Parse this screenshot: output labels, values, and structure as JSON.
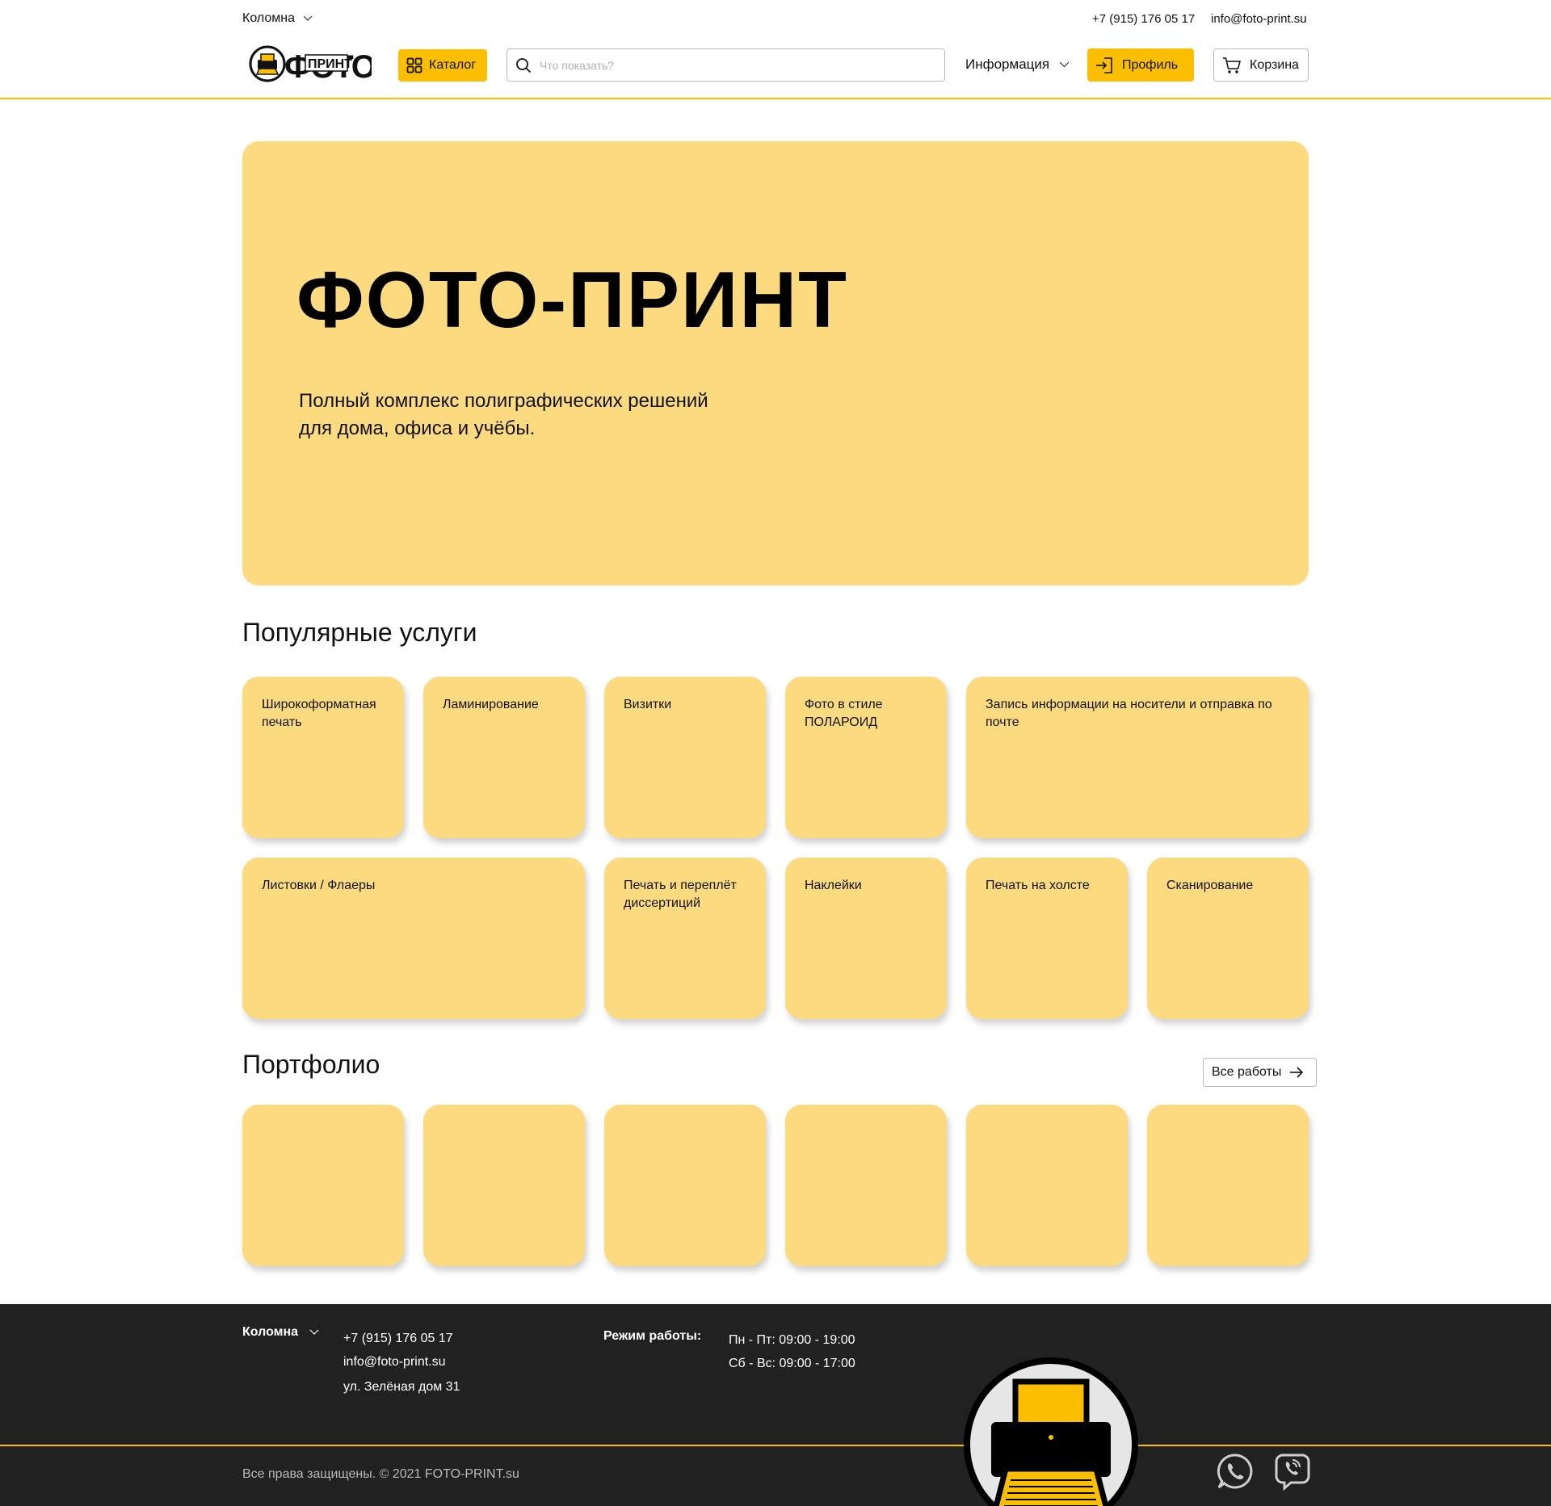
{
  "header": {
    "city": "Коломна",
    "phone": "+7 (915) 176 05 17",
    "email": "info@foto-print.su",
    "catalog_label": "Каталог",
    "search_placeholder": "Что показать?",
    "info_label": "Информация",
    "profile_label": "Профиль",
    "cart_label": "Корзина",
    "logo_text": "ФОТО ПРИНТ"
  },
  "hero": {
    "title": "ФОТО-ПРИНТ",
    "subtitle_line1": "Полный комплекс полиграфических решений",
    "subtitle_line2": "для дома, офиса и учёбы."
  },
  "services": {
    "title": "Популярные услуги",
    "items": [
      {
        "label": "Широкоформатная печать"
      },
      {
        "label": "Ламинирование"
      },
      {
        "label": "Визитки"
      },
      {
        "label": "Фото в стиле ПОЛАРОИД"
      },
      {
        "label": "Запись информации на носители и отправка по почте"
      },
      {
        "label": "Листовки / Флаеры"
      },
      {
        "label": "Печать и переплёт диссертиций"
      },
      {
        "label": "Наклейки"
      },
      {
        "label": "Печать на холсте"
      },
      {
        "label": "Сканирование"
      }
    ]
  },
  "portfolio": {
    "title": "Портфолио",
    "all_works_label": "Все работы",
    "items_count": 6
  },
  "footer": {
    "city": "Коломна",
    "phone": "+7 (915) 176 05 17",
    "email": "info@foto-print.su",
    "address": "ул. Зелёная дом 31",
    "hours_label": "Режим работы:",
    "hours_weekdays": "Пн - Пт: 09:00 - 19:00",
    "hours_weekend": "Сб - Вс: 09:00 - 17:00",
    "copyright": "Все права защищены. © 2021 FOTO-PRINT.su",
    "social": [
      "whatsapp-icon",
      "viber-icon"
    ]
  },
  "colors": {
    "accent": "#fbbe00",
    "card": "#fbda80",
    "footer_bg": "#212121"
  }
}
